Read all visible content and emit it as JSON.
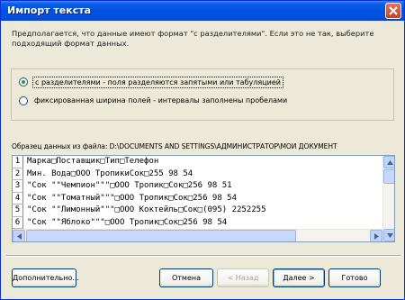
{
  "window": {
    "title": "Импорт текста"
  },
  "description": "Предполагается, что данные имеют формат \"с разделителями\". Если это не так, выберите подходящий формат данных.",
  "options": {
    "delimited_label": "с разделителями - поля разделяются запятыми или табуляцией",
    "fixed_label": "фиксированная ширина полей - интервалы заполнены пробелами",
    "selected": "delimited"
  },
  "sample": {
    "label": "Образец данных из файла: D:\\DOCUMENTS AND SETTINGS\\АДМИНИСТРАТОР\\МОИ ДОКУМЕНТ",
    "rows": [
      {
        "num": "1",
        "text": "Марка□Поставщик□Тип□Телефон"
      },
      {
        "num": "2",
        "text": "Мин. Вода□ООО ТропикиСок□255 98 54"
      },
      {
        "num": "3",
        "text": "\"Сок \"\"Чемпион\"\"\"□ООО Тропик□Сок□256 98 51"
      },
      {
        "num": "4",
        "text": "\"Сок \"\"Томатный\"\"\"□ООО Тропик□Сок□256 98 54"
      },
      {
        "num": "5",
        "text": "\"Сок \"\"Лимонный\"\"\"□ООО Коктейль□Сок□(095) 2252255"
      },
      {
        "num": "6",
        "text": "\"Сок \"\"Яблоко\"\"\"□ООО Тропик□Сок□256 98 54"
      }
    ]
  },
  "buttons": {
    "advanced": "Дополнительно...",
    "cancel": "Отмена",
    "back": "< Назад",
    "next": "Далее >",
    "finish": "Готово"
  },
  "colors": {
    "titlebar": "#0053e1",
    "face": "#ece9d8",
    "accent": "#21a121"
  }
}
